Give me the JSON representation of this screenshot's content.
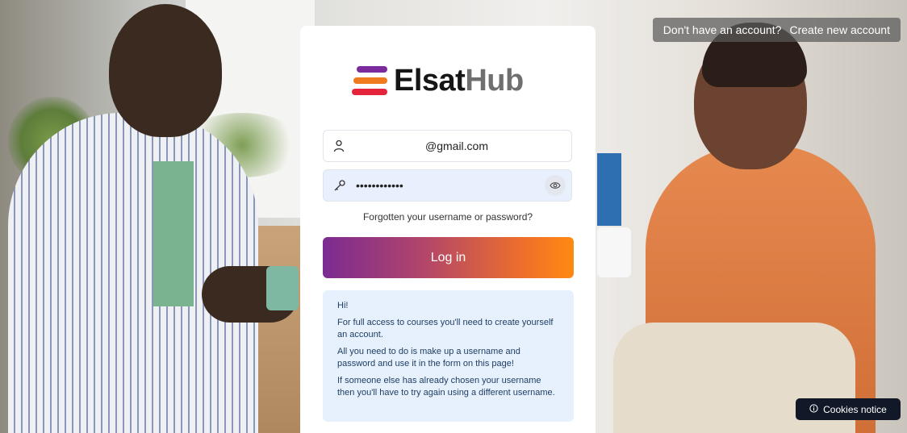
{
  "header": {
    "account_prompt": "Don't have an account?",
    "create_account_link": "Create new account"
  },
  "brand": {
    "name_part1": "Elsat",
    "name_part2": "Hub",
    "colors": [
      "#7b2a9b",
      "#f07a1e",
      "#e3243b"
    ]
  },
  "login_form": {
    "username_value": "@gmail.com",
    "username_icon": "user-icon",
    "password_value": "••••••••••••",
    "password_icon": "key-icon",
    "show_password_icon": "eye-icon",
    "forgot_link": "Forgotten your username or password?",
    "submit_label": "Log in",
    "submit_gradient": [
      "#7b2b92",
      "#ff8a12"
    ]
  },
  "info_box": {
    "paragraphs": [
      "Hi!",
      "For full access to courses you'll need to create yourself an account.",
      "All you need to do is make up a username and password and use it in the form on this page!",
      "If someone else has already chosen your username then you'll have to try again using a different username."
    ]
  },
  "cookies": {
    "icon": "info-icon",
    "label": "Cookies notice"
  }
}
